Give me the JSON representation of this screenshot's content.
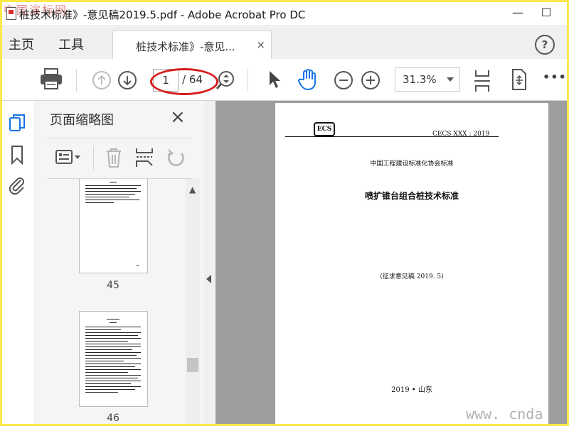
{
  "watermark": "中国演标网",
  "window": {
    "title": "桩技术标准》-意见稿2019.5.pdf - Adobe Acrobat Pro DC",
    "minimize": "—",
    "maximize": "☐"
  },
  "menu": {
    "home": "主页",
    "tools": "工具",
    "tab_label": "桩技术标准》-意见...",
    "tab_close": "×",
    "help": "?"
  },
  "toolbar": {
    "current_page": "1",
    "total_pages": "/ 64",
    "zoom": "31.3%",
    "more": "•••",
    "highlight_color": "#d71c1c"
  },
  "panel": {
    "title": "页面缩略图",
    "close": "×",
    "thumbnails": [
      {
        "label": "45"
      },
      {
        "label": "46"
      }
    ]
  },
  "document": {
    "logo": "ECS",
    "code": "CECS    XXX  : 2019",
    "association": "中国工程建设标准化协会标准",
    "title": "喷扩锥台组合桩技术标准",
    "draft": "(征求意见稿 2019. 5)",
    "footer": "2019  • 山东"
  },
  "site_watermark": "www. cnda",
  "colors": {
    "frame": "#fbe84a",
    "accent": "#1473e6",
    "doc_background": "#9e9e9e"
  }
}
